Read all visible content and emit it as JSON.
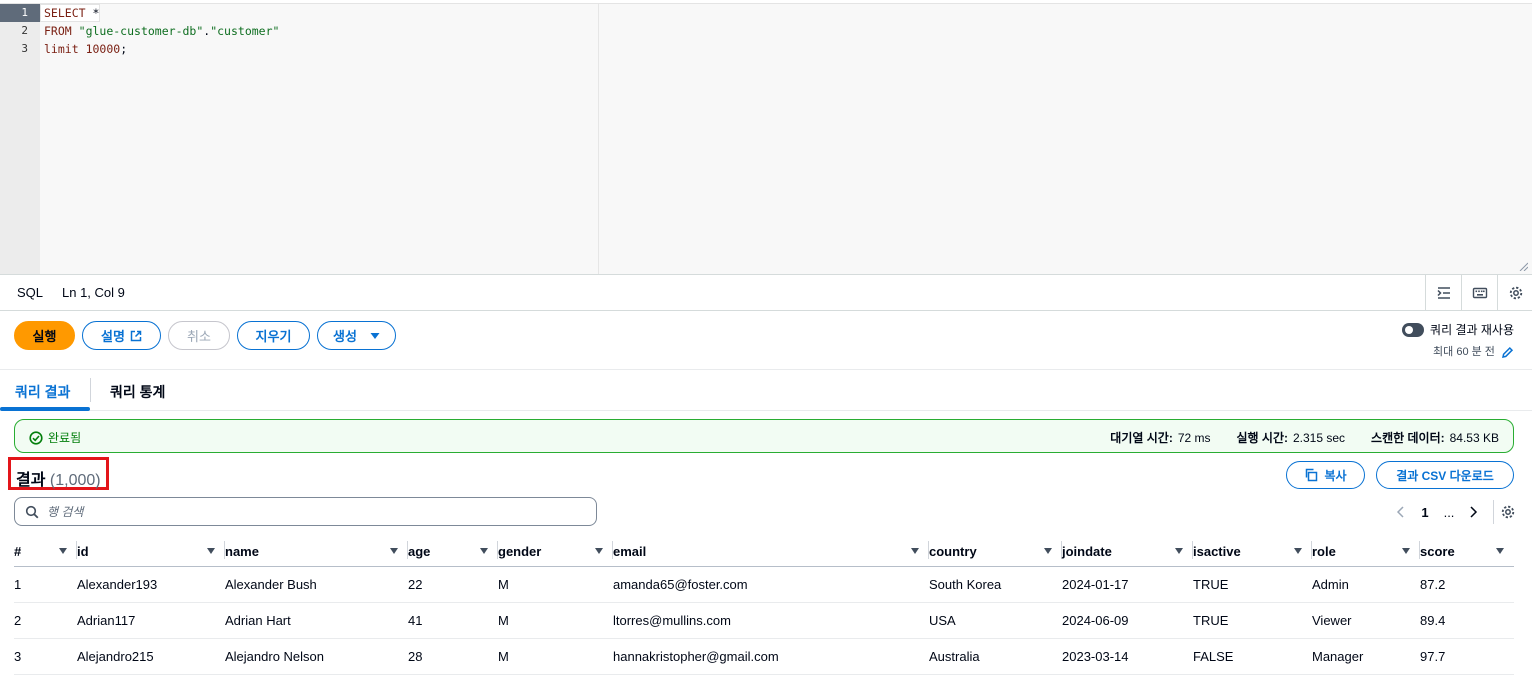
{
  "editor": {
    "line_numbers": [
      "1",
      "2",
      "3"
    ],
    "lines": [
      [
        {
          "t": "SELECT",
          "c": "kw"
        },
        {
          "t": " *",
          "c": ""
        }
      ],
      [
        {
          "t": "FROM",
          "c": "kw"
        },
        {
          "t": " ",
          "c": ""
        },
        {
          "t": "\"glue-customer-db\"",
          "c": "str"
        },
        {
          "t": ".",
          "c": ""
        },
        {
          "t": "\"customer\"",
          "c": "str"
        }
      ],
      [
        {
          "t": "limit",
          "c": "kw"
        },
        {
          "t": " ",
          "c": ""
        },
        {
          "t": "10000",
          "c": "num"
        },
        {
          "t": ";",
          "c": ""
        }
      ]
    ]
  },
  "statusbar": {
    "language": "SQL",
    "cursor": "Ln 1, Col 9",
    "icons": [
      "indent-icon",
      "keyboard-icon",
      "settings-icon"
    ]
  },
  "actions": {
    "run": "실행",
    "explain": "설명",
    "cancel": "취소",
    "clear": "지우기",
    "create": "생성"
  },
  "reuse": {
    "label": "쿼리 결과 재사용",
    "sub": "최대 60 분 전",
    "enabled": false
  },
  "tabs": [
    {
      "label": "쿼리 결과",
      "active": true
    },
    {
      "label": "쿼리 통계",
      "active": false
    }
  ],
  "alert": {
    "status": "완료됨",
    "queue_label": "대기열 시간:",
    "queue_value": "72 ms",
    "exec_label": "실행 시간:",
    "exec_value": "2.315 sec",
    "scan_label": "스캔한 데이터:",
    "scan_value": "84.53 KB"
  },
  "results": {
    "title": "결과",
    "count": "(1,000)",
    "copy": "복사",
    "download": "결과 CSV 다운로드",
    "search_placeholder": "행 검색",
    "page_current": "1",
    "page_more": "..."
  },
  "table": {
    "columns": [
      "#",
      "id",
      "name",
      "age",
      "gender",
      "email",
      "country",
      "joindate",
      "isactive",
      "role",
      "score"
    ],
    "rows": [
      [
        "1",
        "Alexander193",
        "Alexander Bush",
        "22",
        "M",
        "amanda65@foster.com",
        "South Korea",
        "2024-01-17",
        "TRUE",
        "Admin",
        "87.2"
      ],
      [
        "2",
        "Adrian117",
        "Adrian Hart",
        "41",
        "M",
        "ltorres@mullins.com",
        "USA",
        "2024-06-09",
        "TRUE",
        "Viewer",
        "89.4"
      ],
      [
        "3",
        "Alejandro215",
        "Alejandro Nelson",
        "28",
        "M",
        "hannakristopher@gmail.com",
        "Australia",
        "2023-03-14",
        "FALSE",
        "Manager",
        "97.7"
      ]
    ]
  },
  "colors": {
    "primary": "#ff9900",
    "link": "#0972d3",
    "success": "#037f0c",
    "highlight": "#e3151a"
  }
}
